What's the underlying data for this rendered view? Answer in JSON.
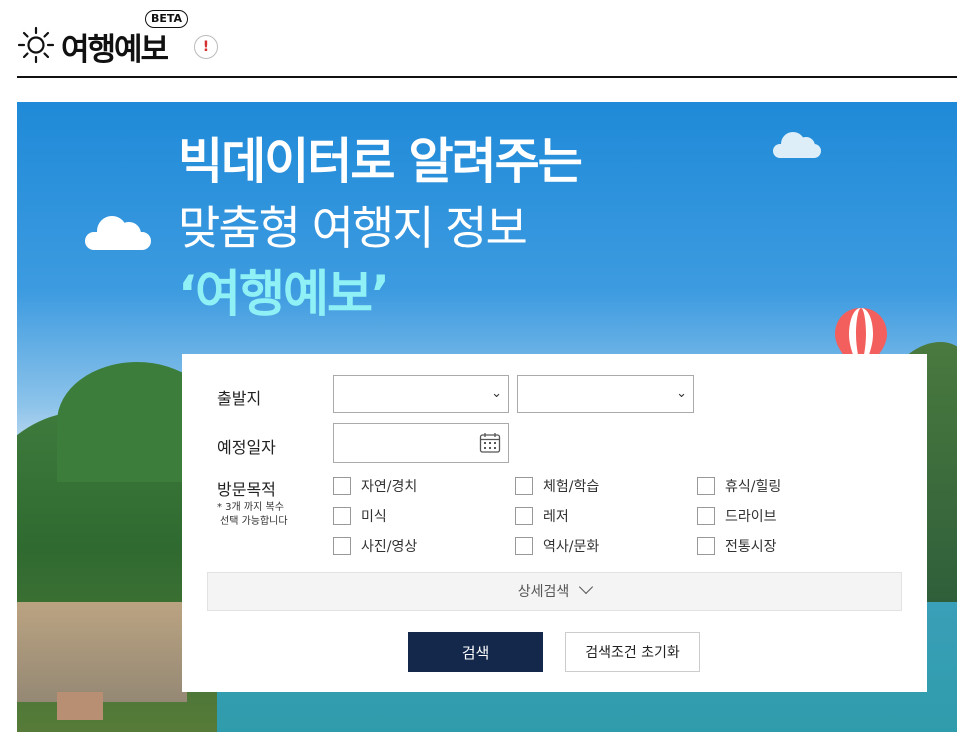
{
  "header": {
    "logo_text": "여행예보",
    "beta_badge": "BETA",
    "alert_mark": "!",
    "sun_icon": "sun-icon",
    "alert_icon": "exclamation-icon"
  },
  "hero": {
    "line1": "빅데이터로 알려주는",
    "line2": "맞춤형 여행지 정보",
    "line3": "‘여행예보’",
    "accent_color": "#8ff0f5"
  },
  "search": {
    "departure_label": "출발지",
    "date_label": "예정일자",
    "purpose_label": "방문목적",
    "purpose_note_line1": "* 3개 까지 복수",
    "purpose_note_line2": "선택 가능합니다",
    "departure_select1_value": "",
    "departure_select2_value": "",
    "date_value": "",
    "purposes": [
      "자연/경치",
      "체험/학습",
      "휴식/힐링",
      "미식",
      "레저",
      "드라이브",
      "사진/영상",
      "역사/문화",
      "전통시장"
    ],
    "detail_label": "상세검색",
    "search_button": "검색",
    "reset_button": "검색조건 초기화",
    "search_button_color": "#13284b"
  }
}
